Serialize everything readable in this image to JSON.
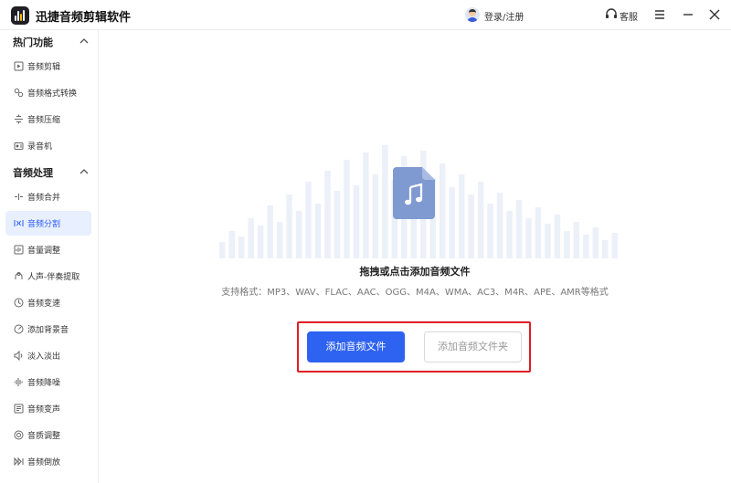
{
  "app": {
    "title": "迅捷音频剪辑软件",
    "login_label": "登录/注册",
    "service_label": "客服"
  },
  "sidebar": {
    "sections": [
      {
        "title": "热门功能",
        "items": [
          {
            "label": "音频剪辑",
            "icon": "audio-clip-icon"
          },
          {
            "label": "音频格式转换",
            "icon": "format-convert-icon"
          },
          {
            "label": "音频压缩",
            "icon": "compress-icon"
          },
          {
            "label": "录音机",
            "icon": "recorder-icon"
          }
        ]
      },
      {
        "title": "音频处理",
        "items": [
          {
            "label": "音频合并",
            "icon": "merge-icon"
          },
          {
            "label": "音频分割",
            "icon": "split-icon",
            "active": true
          },
          {
            "label": "音量调整",
            "icon": "volume-icon"
          },
          {
            "label": "人声-伴奏提取",
            "icon": "vocal-extract-icon"
          },
          {
            "label": "音频变速",
            "icon": "speed-icon"
          },
          {
            "label": "添加背景音",
            "icon": "background-music-icon"
          },
          {
            "label": "淡入淡出",
            "icon": "fade-icon"
          },
          {
            "label": "音频降噪",
            "icon": "denoise-icon"
          },
          {
            "label": "音频变声",
            "icon": "voice-change-icon"
          },
          {
            "label": "音质调整",
            "icon": "quality-icon"
          },
          {
            "label": "音频倒放",
            "icon": "reverse-icon"
          }
        ]
      }
    ]
  },
  "main": {
    "drop_text": "拖拽或点击添加音频文件",
    "formats_text": "支持格式：MP3、WAV、FLAC、AAC、OGG、M4A、WMA、AC3、M4R、APE、AMR等格式",
    "add_file_button": "添加音频文件",
    "add_folder_button": "添加音频文件夹"
  },
  "colors": {
    "accent": "#2e62f0",
    "highlight_border": "#e01d24",
    "active_bg": "#e8efff",
    "file_icon": "#7f9ad0"
  }
}
